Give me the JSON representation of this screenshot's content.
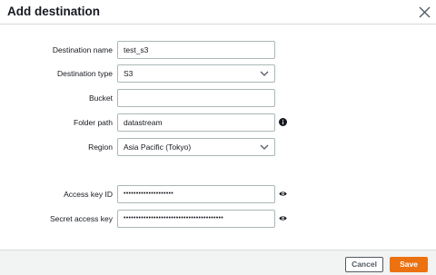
{
  "dialog": {
    "title": "Add destination"
  },
  "form": {
    "destination_name": {
      "label": "Destination name",
      "value": "test_s3"
    },
    "destination_type": {
      "label": "Destination type",
      "value": "S3"
    },
    "bucket": {
      "label": "Bucket",
      "value": ""
    },
    "folder_path": {
      "label": "Folder path",
      "value": "datastream"
    },
    "region": {
      "label": "Region",
      "value": "Asia Pacific (Tokyo)"
    },
    "access_key_id": {
      "label": "Access key ID",
      "value": "••••••••••••••••••••"
    },
    "secret_access_key": {
      "label": "Secret access key",
      "value": "••••••••••••••••••••••••••••••••••••••••"
    }
  },
  "footer": {
    "cancel_label": "Cancel",
    "save_label": "Save"
  },
  "icons": {
    "close": "close-icon",
    "info": "info-icon",
    "eye": "eye-icon",
    "chevron": "chevron-down-icon"
  },
  "colors": {
    "primary": "#ec7211",
    "border": "#aab7b8",
    "footer_bg": "#f2f3f3",
    "text": "#16191f"
  }
}
